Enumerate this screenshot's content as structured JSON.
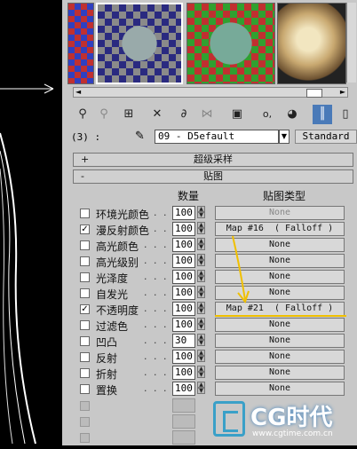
{
  "colors": {
    "panel": "#c8c8c8",
    "accent": "#f0c000",
    "viewport": "#000000"
  },
  "material_name": "09 - D5efault",
  "material_type": "Standard",
  "node_label": "(3) :",
  "rollouts": {
    "supersampling": {
      "sign": "+",
      "title": "超级采样"
    },
    "maps": {
      "sign": "-",
      "title": "贴图"
    }
  },
  "headers": {
    "amount": "数量",
    "map_type": "贴图类型"
  },
  "map_rows": [
    {
      "label": "环境光颜色",
      "checked": false,
      "amount": "100",
      "map": "None",
      "active": false
    },
    {
      "label": "漫反射颜色",
      "checked": true,
      "amount": "100",
      "map": "Map #16  ( Falloff )",
      "active": true
    },
    {
      "label": "高光颜色",
      "checked": false,
      "amount": "100",
      "map": "None",
      "active": true
    },
    {
      "label": "高光级别",
      "checked": false,
      "amount": "100",
      "map": "None",
      "active": true
    },
    {
      "label": "光泽度",
      "checked": false,
      "amount": "100",
      "map": "None",
      "active": true
    },
    {
      "label": "自发光",
      "checked": false,
      "amount": "100",
      "map": "None",
      "active": true
    },
    {
      "label": "不透明度",
      "checked": true,
      "amount": "100",
      "map": "Map #21  ( Falloff )",
      "active": true
    },
    {
      "label": "过滤色",
      "checked": false,
      "amount": "100",
      "map": "None",
      "active": true
    },
    {
      "label": "凹凸",
      "checked": false,
      "amount": "30",
      "map": "None",
      "active": true
    },
    {
      "label": "反射",
      "checked": false,
      "amount": "100",
      "map": "None",
      "active": true
    },
    {
      "label": "折射",
      "checked": false,
      "amount": "100",
      "map": "None",
      "active": true
    },
    {
      "label": "置换",
      "checked": false,
      "amount": "100",
      "map": "None",
      "active": true
    }
  ],
  "watermark": {
    "brand": "CG时代",
    "url": "www.cgtime.com.cn"
  },
  "toolbar_icons": [
    "get-material-icon",
    "put-to-scene-icon",
    "assign-material-icon",
    "reset-icon",
    "make-copy-icon",
    "make-unique-icon",
    "put-to-library-icon",
    "material-id-icon",
    "show-map-icon",
    "show-end-result-icon",
    "go-to-parent-icon"
  ]
}
